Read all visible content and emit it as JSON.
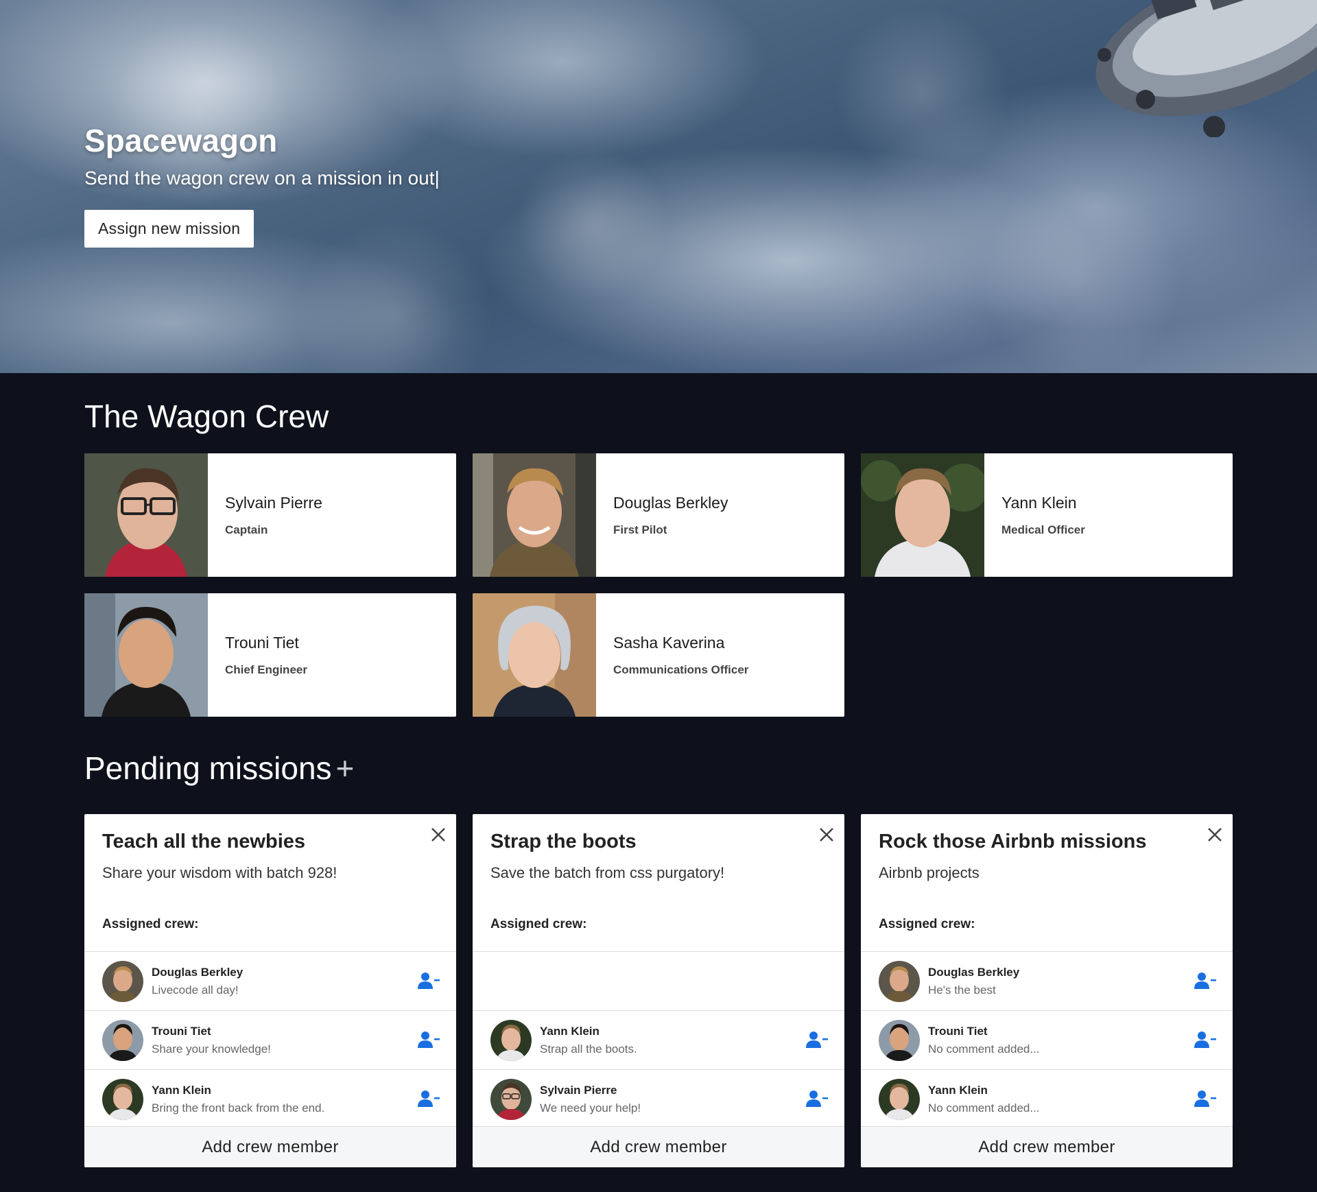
{
  "hero": {
    "title": "Spacewagon",
    "subtitle": "Send the wagon crew on a mission in out|",
    "button_label": "Assign new mission"
  },
  "crew_section": {
    "title": "The Wagon Crew",
    "members": [
      {
        "name": "Sylvain Pierre",
        "role": "Captain"
      },
      {
        "name": "Douglas Berkley",
        "role": "First Pilot"
      },
      {
        "name": "Yann Klein",
        "role": "Medical Officer"
      },
      {
        "name": "Trouni Tiet",
        "role": "Chief Engineer"
      },
      {
        "name": "Sasha Kaverina",
        "role": "Communications Officer"
      }
    ]
  },
  "missions_section": {
    "title": "Pending missions",
    "add_symbol": "+",
    "assigned_label": "Assigned crew:",
    "add_member_label": "Add crew member",
    "missions": [
      {
        "title": "Teach all the newbies",
        "description": "Share your wisdom with batch 928!",
        "crew": [
          {
            "name": "Douglas Berkley",
            "comment": "Livecode all day!"
          },
          {
            "name": "Trouni Tiet",
            "comment": "Share your knowledge!"
          },
          {
            "name": "Yann Klein",
            "comment": "Bring the front back from the end."
          }
        ]
      },
      {
        "title": "Strap the boots",
        "description": "Save the batch from css purgatory!",
        "crew": [
          {
            "name": "Yann Klein",
            "comment": "Strap all the boots."
          },
          {
            "name": "Sylvain Pierre",
            "comment": "We need your help!"
          }
        ]
      },
      {
        "title": "Rock those Airbnb missions",
        "description": "Airbnb projects",
        "crew": [
          {
            "name": "Douglas Berkley",
            "comment": "He's the best"
          },
          {
            "name": "Trouni Tiet",
            "comment": "No comment added..."
          },
          {
            "name": "Yann Klein",
            "comment": "No comment added..."
          }
        ]
      }
    ]
  },
  "colors": {
    "page_background": "#0e111b",
    "card_background": "#ffffff",
    "accent_blue": "#1a6fe0",
    "footer_background": "#f5f6f8"
  },
  "icons": {
    "close": "close-icon",
    "remove_member": "remove-user-icon",
    "add": "plus-icon"
  }
}
